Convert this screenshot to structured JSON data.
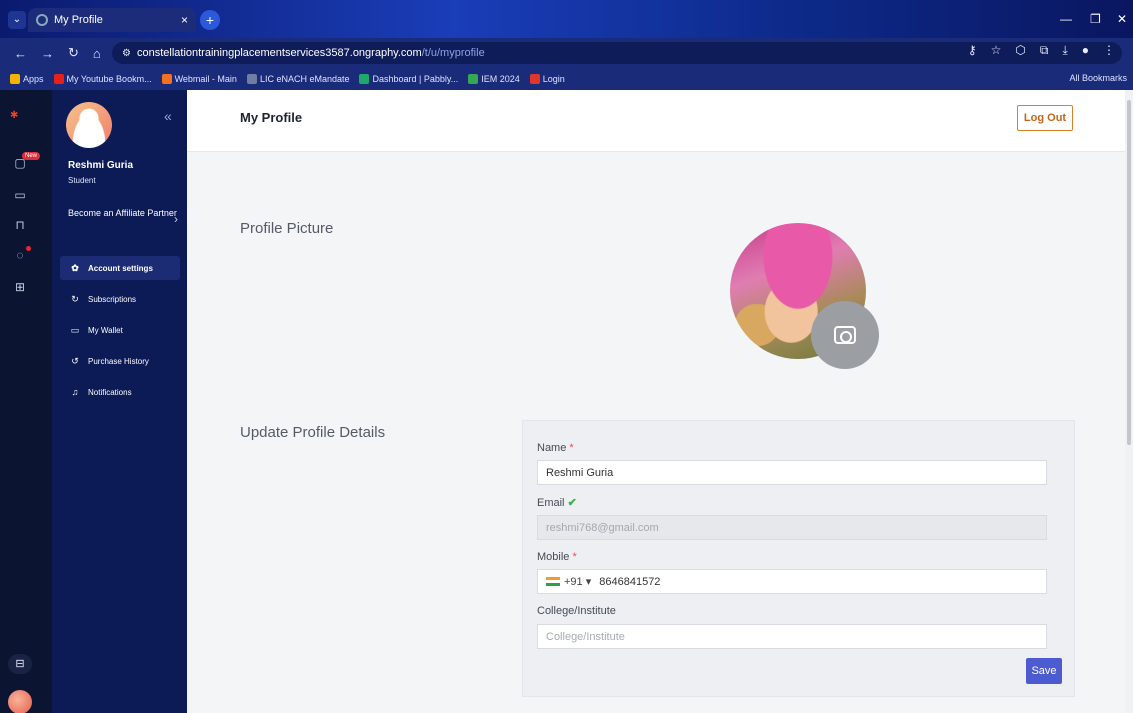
{
  "browser": {
    "tab_title": "My Profile",
    "tab_close": "×",
    "new_tab": "+",
    "url_host": "constellationtrainingplacementservices3587.ongraphy.com",
    "url_path": "/t/u/myprofile",
    "bookmarks": [
      {
        "label": "Apps",
        "color": "#f4b400"
      },
      {
        "label": "My Youtube Bookm...",
        "color": "#e62117"
      },
      {
        "label": "Webmail - Main",
        "color": "#f37021"
      },
      {
        "label": "LIC eNACH eMandate",
        "color": "#6f7fa0"
      },
      {
        "label": "Dashboard | Pabbly...",
        "color": "#1ea86b"
      },
      {
        "label": "IEM 2024",
        "color": "#34a853"
      },
      {
        "label": "Login",
        "color": "#e0362c"
      }
    ],
    "all_bookmarks": "All Bookmarks"
  },
  "rail": {
    "new_badge": "New"
  },
  "sidebar": {
    "user_name": "Reshmi Guria",
    "user_role": "Student",
    "affiliate_label": "Become an Affiliate Partner",
    "collapse_label": "«",
    "menu": [
      {
        "label": "Account settings",
        "icon": "gear-icon",
        "glyph": "✿",
        "active": true
      },
      {
        "label": "Subscriptions",
        "icon": "refresh-icon",
        "glyph": "↻",
        "active": false
      },
      {
        "label": "My Wallet",
        "icon": "wallet-icon",
        "glyph": "▭",
        "active": false
      },
      {
        "label": "Purchase History",
        "icon": "history-icon",
        "glyph": "↺",
        "active": false
      },
      {
        "label": "Notifications",
        "icon": "bell-icon",
        "glyph": "♫",
        "active": false
      }
    ]
  },
  "header": {
    "title": "My Profile",
    "logout_label": "Log Out"
  },
  "profile": {
    "picture_heading": "Profile Picture",
    "details_heading": "Update Profile Details"
  },
  "form": {
    "name_label": "Name",
    "name_value": "Reshmi Guria",
    "email_label": "Email",
    "email_value": "reshmi768@gmail.com",
    "mobile_label": "Mobile",
    "country_code": "+91 ▾",
    "mobile_value": "8646841572",
    "college_label": "College/Institute",
    "college_placeholder": "College/Institute",
    "required_mark": "*",
    "verified_mark": "✔",
    "save_label": "Save"
  },
  "colors": {
    "sidebar_bg": "#0c1a55",
    "accent": "#4d5bd1",
    "logout": "#c7651c"
  }
}
